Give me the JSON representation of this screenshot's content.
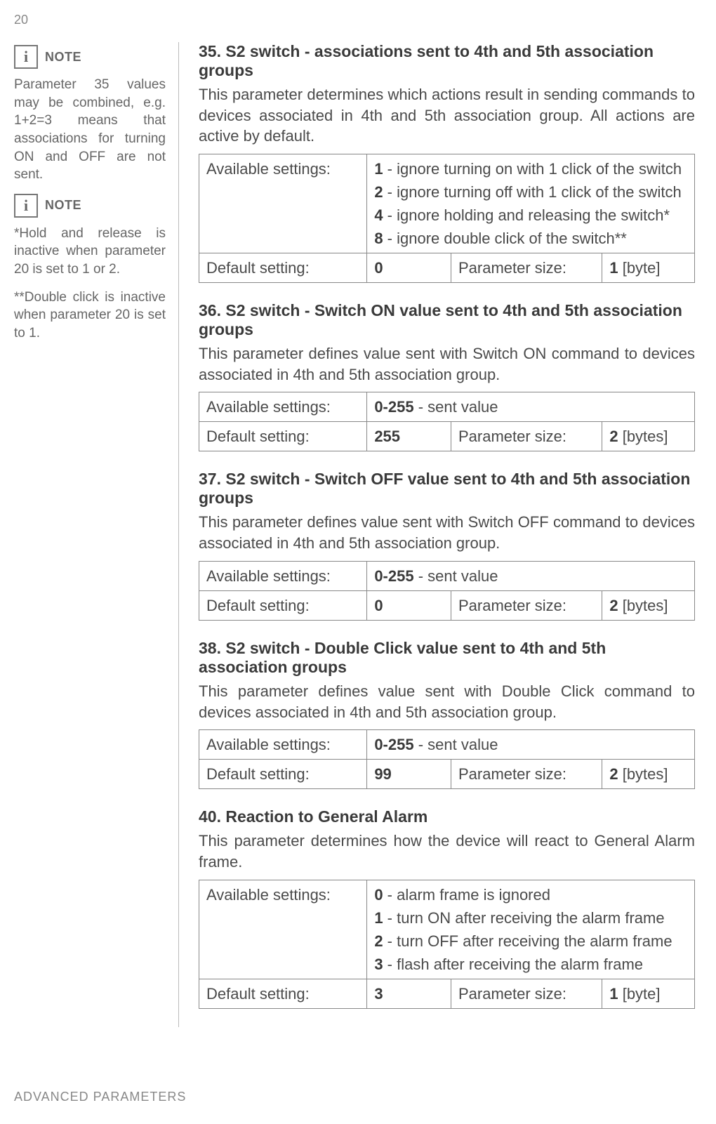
{
  "page_number": "20",
  "footer": "ADVANCED PARAMETERS",
  "side": {
    "note_label": "NOTE",
    "note_icon": "i",
    "p1": "Parameter 35 values may be combined, e.g. 1+2=3 means that associations for turning ON and OFF are not sent.",
    "p2a": "*Hold and release is inactive when parameter 20 is set to 1 or 2.",
    "p2b": "**Double click is inactive when parameter 20 is set to 1."
  },
  "labels": {
    "avail": "Available settings:",
    "default": "Default setting:",
    "psize": "Parameter size:"
  },
  "sec35": {
    "title": "35. S2 switch - associations sent to 4th and 5th association groups",
    "desc": "This parameter determines which actions result in sending commands to devices associated in 4th and 5th association group. All actions are active by default.",
    "o1b": "1",
    "o1": " - ignore turning on with 1 click of the switch",
    "o2b": "2",
    "o2": " - ignore turning off with 1 click of the switch",
    "o3b": "4",
    "o3": " - ignore holding and releasing the switch*",
    "o4b": "8",
    "o4": " - ignore double click of the switch**",
    "def": "0",
    "unitb": "1",
    "unit": " [byte]"
  },
  "sec36": {
    "title": "36. S2 switch - Switch ON value sent to 4th and 5th association groups",
    "desc": "This parameter defines value sent with Switch ON command to devices associated in 4th and 5th association group.",
    "ob": "0-255",
    "o": " - sent value",
    "def": "255",
    "unitb": "2",
    "unit": " [bytes]"
  },
  "sec37": {
    "title": "37. S2 switch - Switch OFF value sent to 4th and 5th association groups",
    "desc": "This parameter defines value sent with Switch OFF command to devices associated in 4th and 5th association group.",
    "ob": "0-255",
    "o": " - sent value",
    "def": "0",
    "unitb": "2",
    "unit": " [bytes]"
  },
  "sec38": {
    "title": "38. S2 switch - Double Click value sent to 4th and 5th association groups",
    "desc": "This parameter defines value sent with Double Click command to devices associated in 4th and 5th association group.",
    "ob": "0-255",
    "o": " - sent value",
    "def": "99",
    "unitb": "2",
    "unit": " [bytes]"
  },
  "sec40": {
    "title": "40. Reaction to General Alarm",
    "desc": "This parameter determines how the device will react to General Alarm frame.",
    "o1b": "0",
    "o1": " - alarm frame is ignored",
    "o2b": "1",
    "o2": " - turn ON after receiving the alarm frame",
    "o3b": "2",
    "o3": " - turn OFF after receiving the alarm frame",
    "o4b": "3",
    "o4": " - flash after receiving the alarm frame",
    "def": "3",
    "unitb": "1",
    "unit": " [byte]"
  }
}
